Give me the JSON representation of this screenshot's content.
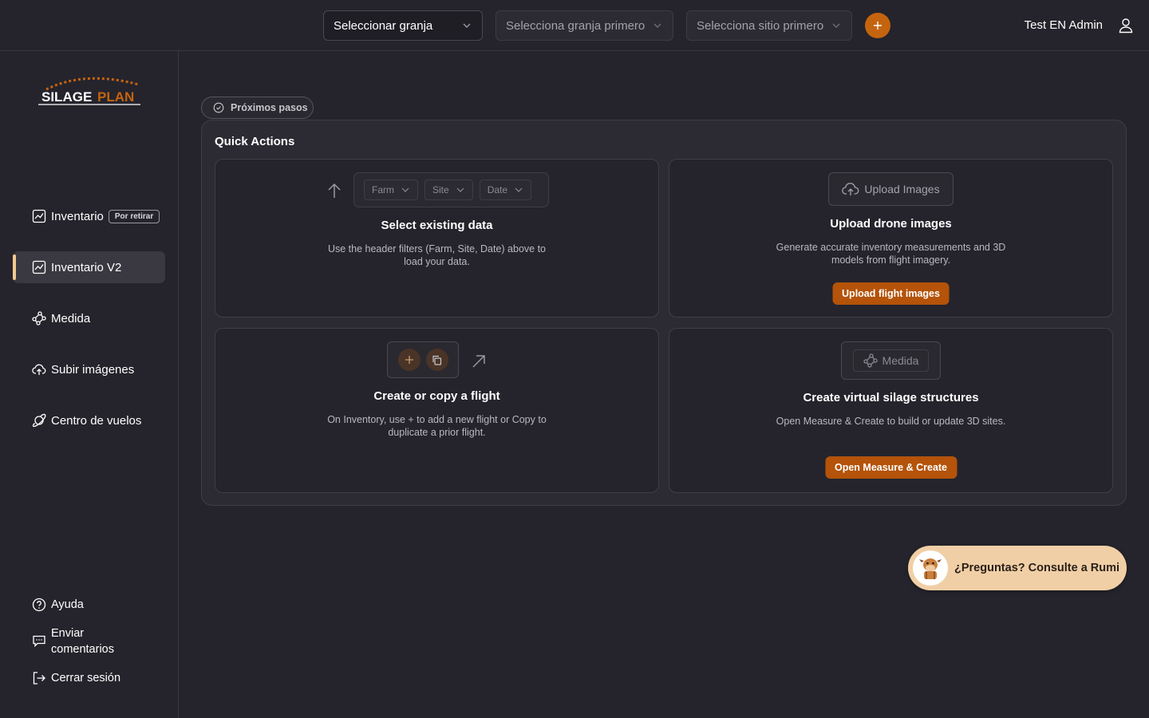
{
  "header": {
    "farm_select": "Seleccionar granja",
    "site_select": "Selecciona granja primero",
    "date_select": "Selecciona sitio primero",
    "user_name": "Test EN Admin"
  },
  "brand": {
    "logo_text_1": "SILAGE",
    "logo_text_2": "PLAN"
  },
  "sidebar": {
    "items": [
      {
        "label": "Inventario",
        "badge": "Por retirar",
        "icon": "chart-icon"
      },
      {
        "label": "Inventario V2",
        "icon": "chart-icon",
        "active": true
      },
      {
        "label": "Medida",
        "icon": "measure-icon"
      },
      {
        "label": "Subir imágenes",
        "icon": "cloud-upload-icon"
      },
      {
        "label": "Centro de vuelos",
        "icon": "planet-icon"
      }
    ],
    "footer": {
      "help": "Ayuda",
      "feedback": "Enviar comentarios",
      "logout": "Cerrar sesión"
    }
  },
  "main": {
    "next_steps_label": "Próximos pasos",
    "quick_actions_title": "Quick Actions",
    "cards": {
      "select_data": {
        "filters": [
          "Farm",
          "Site",
          "Date"
        ],
        "title": "Select existing data",
        "description": "Use the header filters (Farm, Site, Date) above to load your data."
      },
      "upload": {
        "box_label": "Upload Images",
        "title": "Upload drone images",
        "description": "Generate accurate inventory measurements and 3D models from flight imagery.",
        "button": "Upload flight images"
      },
      "flight": {
        "title": "Create or copy a flight",
        "description": "On Inventory, use + to add a new flight or Copy to duplicate a prior flight."
      },
      "measure": {
        "box_label": "Medida",
        "title": "Create virtual silage structures",
        "description": "Open Measure & Create to build or update 3D sites.",
        "button": "Open Measure & Create"
      }
    }
  },
  "assistant": {
    "label": "¿Preguntas? Consulte a Rumi"
  },
  "colors": {
    "accent": "#c5640f",
    "button": "#b45309",
    "background": "#25242c",
    "assistant_bg": "#f1cfa6"
  }
}
